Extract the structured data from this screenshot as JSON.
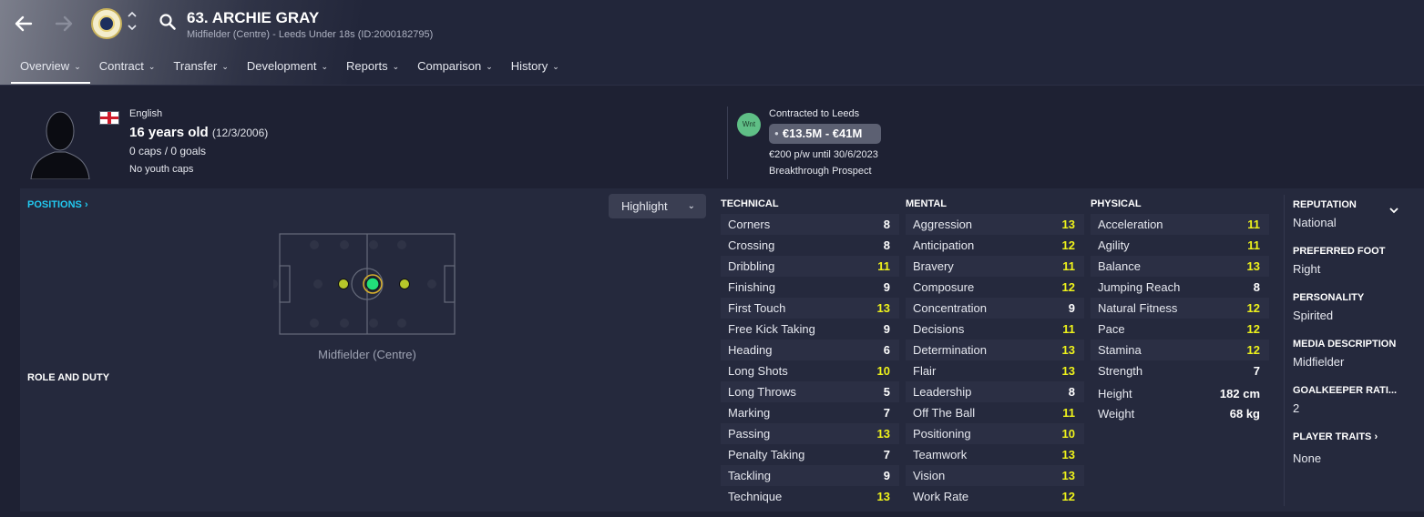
{
  "header": {
    "player_title": "63. ARCHIE GRAY",
    "player_subtitle": "Midfielder (Centre) - Leeds Under 18s (ID:2000182795)",
    "back_icon": "arrow-left-icon",
    "forward_icon": "arrow-right-icon",
    "search_icon": "search-icon"
  },
  "tabs": [
    {
      "label": "Overview",
      "active": true
    },
    {
      "label": "Contract"
    },
    {
      "label": "Transfer"
    },
    {
      "label": "Development"
    },
    {
      "label": "Reports"
    },
    {
      "label": "Comparison"
    },
    {
      "label": "History"
    }
  ],
  "profile": {
    "nationality": "English",
    "age": "16 years old",
    "dob": "(12/3/2006)",
    "caps": "0 caps / 0 goals",
    "youth_caps": "No youth caps"
  },
  "contract": {
    "badge": "Wnt",
    "contracted_to": "Contracted to Leeds",
    "value_range": "€13.5M - €41M",
    "wage": "€200 p/w until 30/6/2023",
    "status": "Breakthrough Prospect"
  },
  "positions": {
    "link": "POSITIONS",
    "highlight_label": "Highlight",
    "position_label": "Midfielder (Centre)",
    "role_title": "ROLE AND DUTY"
  },
  "technical": {
    "title": "TECHNICAL",
    "attrs": [
      {
        "name": "Corners",
        "value": "8"
      },
      {
        "name": "Crossing",
        "value": "8"
      },
      {
        "name": "Dribbling",
        "value": "11"
      },
      {
        "name": "Finishing",
        "value": "9"
      },
      {
        "name": "First Touch",
        "value": "13"
      },
      {
        "name": "Free Kick Taking",
        "value": "9"
      },
      {
        "name": "Heading",
        "value": "6"
      },
      {
        "name": "Long Shots",
        "value": "10"
      },
      {
        "name": "Long Throws",
        "value": "5"
      },
      {
        "name": "Marking",
        "value": "7"
      },
      {
        "name": "Passing",
        "value": "13"
      },
      {
        "name": "Penalty Taking",
        "value": "7"
      },
      {
        "name": "Tackling",
        "value": "9"
      },
      {
        "name": "Technique",
        "value": "13"
      }
    ]
  },
  "mental": {
    "title": "MENTAL",
    "attrs": [
      {
        "name": "Aggression",
        "value": "13"
      },
      {
        "name": "Anticipation",
        "value": "12"
      },
      {
        "name": "Bravery",
        "value": "11"
      },
      {
        "name": "Composure",
        "value": "12"
      },
      {
        "name": "Concentration",
        "value": "9"
      },
      {
        "name": "Decisions",
        "value": "11"
      },
      {
        "name": "Determination",
        "value": "13"
      },
      {
        "name": "Flair",
        "value": "13"
      },
      {
        "name": "Leadership",
        "value": "8"
      },
      {
        "name": "Off The Ball",
        "value": "11"
      },
      {
        "name": "Positioning",
        "value": "10"
      },
      {
        "name": "Teamwork",
        "value": "13"
      },
      {
        "name": "Vision",
        "value": "13"
      },
      {
        "name": "Work Rate",
        "value": "12"
      }
    ]
  },
  "physical": {
    "title": "PHYSICAL",
    "attrs": [
      {
        "name": "Acceleration",
        "value": "11"
      },
      {
        "name": "Agility",
        "value": "11"
      },
      {
        "name": "Balance",
        "value": "13"
      },
      {
        "name": "Jumping Reach",
        "value": "8"
      },
      {
        "name": "Natural Fitness",
        "value": "12"
      },
      {
        "name": "Pace",
        "value": "12"
      },
      {
        "name": "Stamina",
        "value": "12"
      },
      {
        "name": "Strength",
        "value": "7"
      }
    ],
    "height_label": "Height",
    "height_value": "182 cm",
    "weight_label": "Weight",
    "weight_value": "68 kg"
  },
  "side": {
    "reputation_label": "REPUTATION",
    "reputation_value": "National",
    "foot_label": "PREFERRED FOOT",
    "foot_value": "Right",
    "personality_label": "PERSONALITY",
    "personality_value": "Spirited",
    "media_label": "MEDIA DESCRIPTION",
    "media_value": "Midfielder",
    "gk_label": "GOALKEEPER RATI...",
    "gk_value": "2",
    "traits_label": "PLAYER TRAITS",
    "traits_value": "None"
  },
  "colors": {
    "background": "#1e2133",
    "panel": "#25293d",
    "accent_link": "#22c9f0",
    "good_attribute": "#eef21b",
    "natural_position": "#22e07a"
  }
}
